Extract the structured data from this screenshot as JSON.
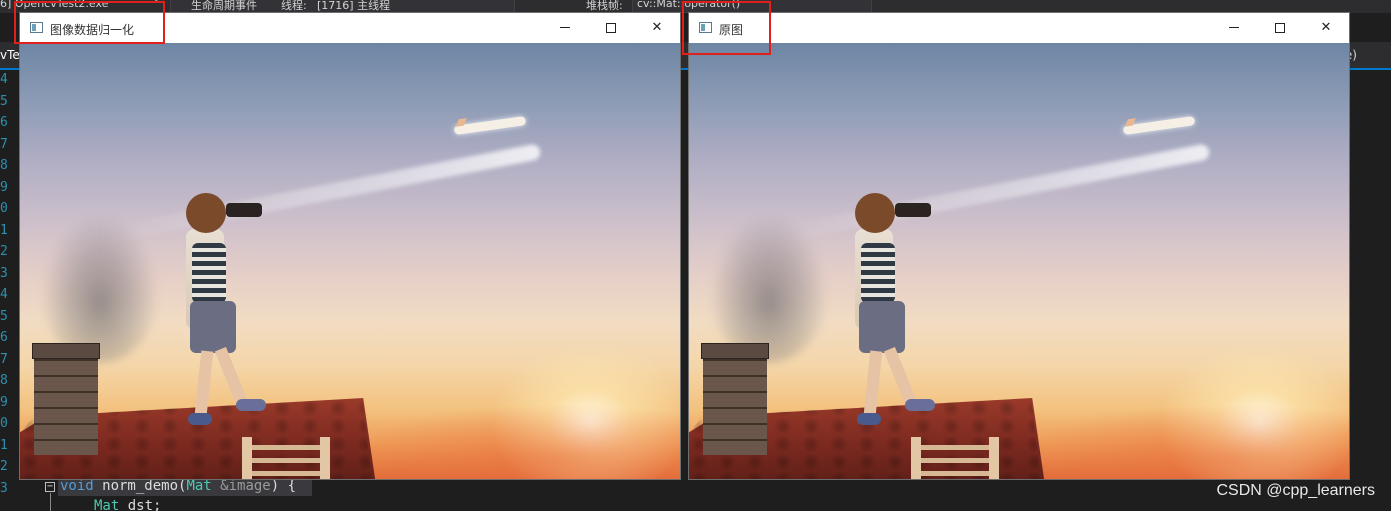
{
  "ide": {
    "toolbar": {
      "process": "6] OpencvTest2.exe",
      "lifecycle": "生命周期事件",
      "thread_label": "线程:",
      "thread_value": "[1716] 主线程",
      "stack_label": "堆栈帧:",
      "stack_value": "cv::Mat::operator()"
    },
    "tab_left": "vTe",
    "tab_right": "e)",
    "line_numbers": [
      "4",
      "5",
      "6",
      "7",
      "8",
      "9",
      "0",
      "1",
      "2",
      "3",
      "4",
      "5",
      "6",
      "7",
      "8",
      "9",
      "0",
      "1",
      "2",
      "3"
    ],
    "code": {
      "line1_kw": "void",
      "line1_fn": " norm_demo(",
      "line1_type": "Mat",
      "line1_rest": " &image",
      "line1_end": ") {",
      "line2_type": "Mat",
      "line2_rest": " dst;"
    },
    "fold_symbol": "−"
  },
  "windows": [
    {
      "title": "图像数据归一化",
      "image": "boy-on-roof-photo",
      "highlighted": true
    },
    {
      "title": "原图",
      "image": "boy-on-roof-photo",
      "highlighted": true
    }
  ],
  "window_controls": {
    "minimize_icon": "minimize-icon",
    "maximize_icon": "maximize-icon",
    "close_icon": "close-icon",
    "close_glyph": "✕"
  },
  "watermark": "CSDN @cpp_learners",
  "colors": {
    "highlight_box": "#e0201c",
    "ide_background": "#1e1e1e",
    "keyword": "#569cd6",
    "type": "#4ec9b0",
    "line_number": "#2b91af"
  }
}
